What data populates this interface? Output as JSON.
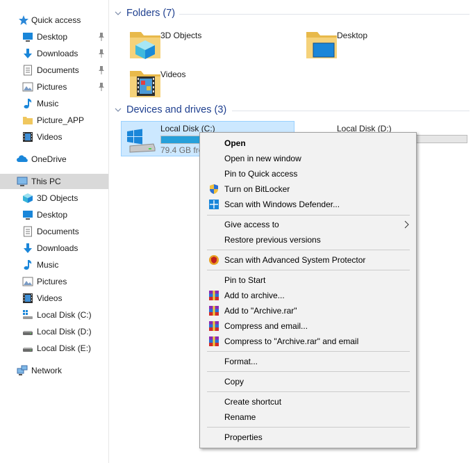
{
  "sidebar": {
    "quick_access": {
      "label": "Quick access",
      "items": [
        {
          "label": "Desktop",
          "pinned": true
        },
        {
          "label": "Downloads",
          "pinned": true
        },
        {
          "label": "Documents",
          "pinned": true
        },
        {
          "label": "Pictures",
          "pinned": true
        },
        {
          "label": "Music",
          "pinned": false
        },
        {
          "label": "Picture_APP",
          "pinned": false
        },
        {
          "label": "Videos",
          "pinned": false
        }
      ]
    },
    "onedrive": {
      "label": "OneDrive"
    },
    "this_pc": {
      "label": "This PC",
      "items": [
        {
          "label": "3D Objects"
        },
        {
          "label": "Desktop"
        },
        {
          "label": "Documents"
        },
        {
          "label": "Downloads"
        },
        {
          "label": "Music"
        },
        {
          "label": "Pictures"
        },
        {
          "label": "Videos"
        },
        {
          "label": "Local Disk (C:)"
        },
        {
          "label": "Local Disk (D:)"
        },
        {
          "label": "Local Disk (E:)"
        }
      ]
    },
    "network": {
      "label": "Network"
    }
  },
  "main": {
    "folders": {
      "header": "Folders (7)",
      "items": [
        {
          "label": "3D Objects",
          "icon": "3d-objects-folder-icon"
        },
        {
          "label": "Desktop",
          "icon": "desktop-folder-icon"
        },
        {
          "label": "Videos",
          "icon": "videos-folder-icon"
        }
      ]
    },
    "drives": {
      "header": "Devices and drives (3)",
      "items": [
        {
          "name": "Local Disk (C:)",
          "free": "79.4 GB fre",
          "used_fraction": 0.9,
          "selected": true
        },
        {
          "name": "Local Disk (D:)",
          "free": "",
          "used_fraction": 0.0,
          "selected": false
        }
      ]
    }
  },
  "context_menu": {
    "items": {
      "open": "Open",
      "open_new_window": "Open in new window",
      "pin_quick_access": "Pin to Quick access",
      "bitlocker": "Turn on BitLocker",
      "defender": "Scan with Windows Defender...",
      "give_access": "Give access to",
      "restore_versions": "Restore previous versions",
      "asp_scan": "Scan with Advanced System Protector",
      "pin_start": "Pin to Start",
      "add_archive": "Add to archive...",
      "add_archive_rar": "Add to \"Archive.rar\"",
      "compress_email": "Compress and email...",
      "compress_rar_email": "Compress to \"Archive.rar\" and email",
      "format": "Format...",
      "copy": "Copy",
      "create_shortcut": "Create shortcut",
      "rename": "Rename",
      "properties": "Properties"
    }
  },
  "colors": {
    "accent_blue": "#26a0da",
    "header_blue": "#1e3f8f",
    "selection_bg": "#cce8ff",
    "menu_bg": "#f2f2f2"
  }
}
